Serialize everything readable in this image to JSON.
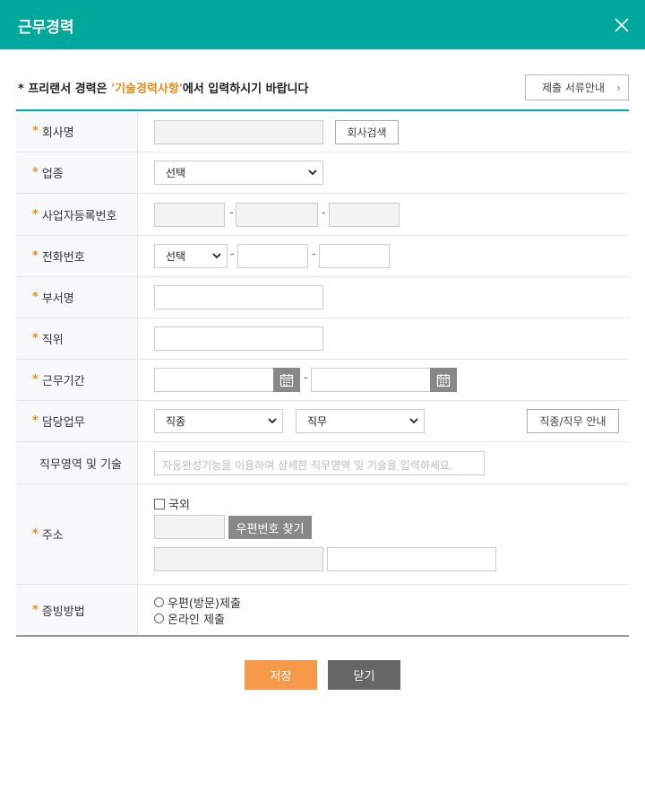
{
  "header": {
    "title": "근무경력"
  },
  "notice": {
    "prefix": "* 프리랜서 경력은 ",
    "highlight": "'기술경력사항'",
    "suffix": "에서 입력하시기 바랍니다"
  },
  "guide_button": {
    "label": "제출 서류안내",
    "chevron": "›"
  },
  "rows": {
    "company": {
      "label": "회사명",
      "search_button": "회사검색"
    },
    "industry": {
      "label": "업종",
      "selected": "선택"
    },
    "business_no": {
      "label": "사업자등록번호",
      "sep": "-"
    },
    "phone": {
      "label": "전화번호",
      "selected": "선택",
      "sep": "-"
    },
    "department": {
      "label": "부서명"
    },
    "position": {
      "label": "직위"
    },
    "period": {
      "label": "근무기간",
      "sep": "-"
    },
    "duty": {
      "label": "담당업무",
      "job_type": "직종",
      "job": "직무",
      "guide_button": "직종/직무 안내"
    },
    "skills": {
      "label": "직무영역 및 기술",
      "placeholder": "자동완성기능을 이용하여 상세한 직무영역 및 기술을 입력하세요."
    },
    "address": {
      "label": "주소",
      "overseas": "국외",
      "zip_button": "우편번호 찾기"
    },
    "proof": {
      "label": "증빙방법",
      "options": [
        "우편(방문)제출",
        "온라인 제출"
      ]
    }
  },
  "actions": {
    "save": "저장",
    "close": "닫기"
  },
  "colors": {
    "accent": "#00a89c",
    "highlight": "#f08a1c",
    "save": "#f7994a",
    "close": "#666666"
  }
}
